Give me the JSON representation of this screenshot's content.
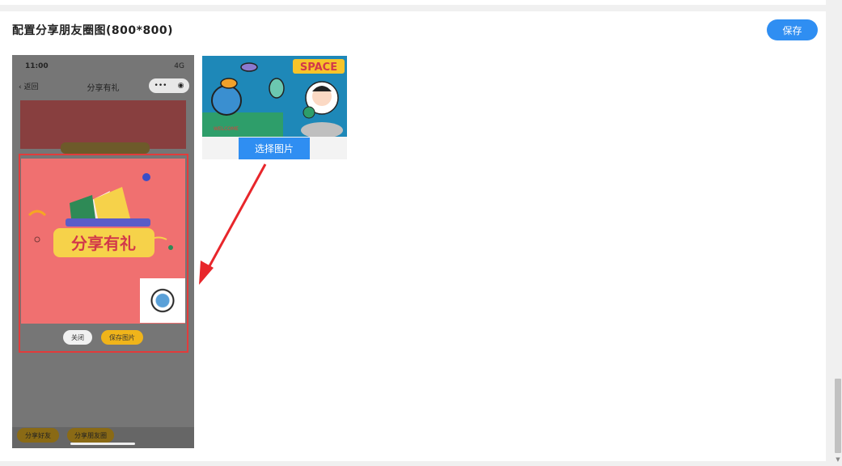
{
  "section": {
    "title": "配置分享朋友圈图(800*800)",
    "save_label": "保存"
  },
  "phone": {
    "status_time": "11:00",
    "status_signal": "4G",
    "nav_back": "返回",
    "nav_title": "分享有礼",
    "capsule_more": "•••",
    "card_headline": "分享有礼",
    "close_label": "关闭",
    "save_image_label": "保存图片",
    "bottom_share_friend": "分享好友",
    "bottom_share_moments": "分享朋友圈"
  },
  "uploader": {
    "select_label": "选择图片",
    "thumb_text": "SPACE"
  },
  "colors": {
    "accent": "#2f8ef2",
    "highlight": "#e23b3b",
    "card": "#f07070",
    "gold": "#f0b41a"
  }
}
